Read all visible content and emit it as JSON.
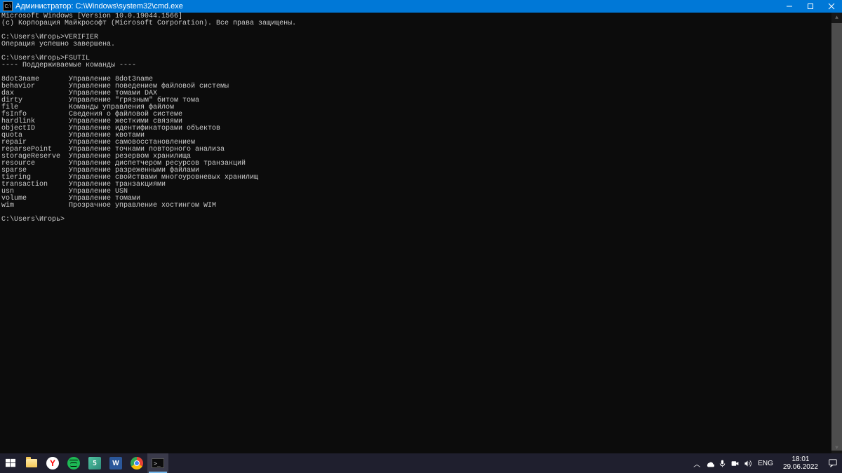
{
  "titlebar": {
    "label": "Администратор: ",
    "path": "C:\\Windows\\system32\\cmd.exe"
  },
  "terminal": {
    "lines": [
      "Microsoft Windows [Version 10.0.19044.1566]",
      "(c) Корпорация Майкрософт (Microsoft Corporation). Все права защищены.",
      "",
      "C:\\Users\\Игорь>VERIFIER",
      "Операция успешно завершена.",
      "",
      "C:\\Users\\Игорь>FSUTIL",
      "---- Поддерживаемые команды ----",
      "",
      "8dot3name       Управление 8dot3name",
      "behavior        Управление поведением файловой системы",
      "dax             Управление томами DAX",
      "dirty           Управление \"грязным\" битом тома",
      "file            Команды управления файлом",
      "fsInfo          Сведения о файловой системе",
      "hardlink        Управление жесткими связями",
      "objectID        Управление идентификаторами объектов",
      "quota           Управление квотами",
      "repair          Управление самовосстановлением",
      "reparsePoint    Управление точками повторного анализа",
      "storageReserve  Управление резервом хранилища",
      "resource        Управление диспетчером ресурсов транзакций",
      "sparse          Управление разреженными файлами",
      "tiering         Управление свойствами многоуровневых хранилищ",
      "transaction     Управление транзакциями",
      "usn             Управление USN",
      "volume          Управление томами",
      "wim             Прозрачное управление хостингом WIM",
      "",
      "C:\\Users\\Игорь>"
    ]
  },
  "tray": {
    "lang": "ENG",
    "time": "18:01",
    "date": "29.06.2022"
  },
  "icons": {
    "yandex": "Y",
    "word": "W",
    "cmd": ">_",
    "teal_badge": "5"
  }
}
